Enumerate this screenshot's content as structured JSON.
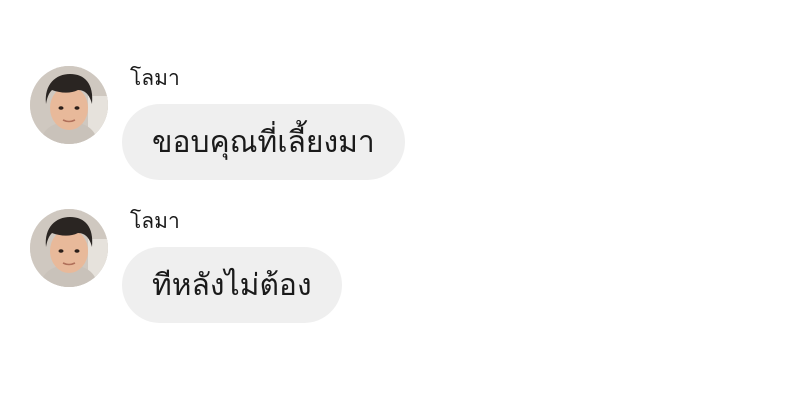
{
  "conversation": {
    "messages": [
      {
        "sender": "โลมา",
        "avatar_icon": "child-face-avatar",
        "text": "ขอบคุณที่เลี้ยงมา"
      },
      {
        "sender": "โลมา",
        "avatar_icon": "child-face-avatar",
        "text": "ทีหลังไม่ต้อง"
      }
    ]
  },
  "colors": {
    "background": "#ffffff",
    "bubble": "#efefef",
    "text": "#1a1a1a"
  }
}
